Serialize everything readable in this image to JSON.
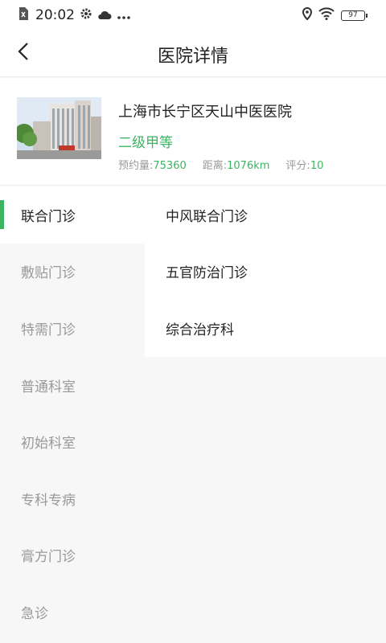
{
  "status_bar": {
    "time": "20:02",
    "battery": "97",
    "icons": [
      "sim-icon",
      "gear-icon",
      "cloud-icon",
      "more-icon",
      "location-icon",
      "wifi-icon",
      "battery-icon"
    ]
  },
  "nav": {
    "title": "医院详情",
    "back_icon": "chevron-left-icon"
  },
  "hospital": {
    "name": "上海市长宁区天山中医医院",
    "level": "二级甲等",
    "stats": {
      "appointments_label": "预约量:",
      "appointments_value": "75360",
      "distance_label": "距离:",
      "distance_value": "1076km",
      "rating_label": "评分:",
      "rating_value": "10"
    }
  },
  "categories": [
    {
      "label": "联合门诊",
      "active": true
    },
    {
      "label": "敷贴门诊"
    },
    {
      "label": "特需门诊"
    },
    {
      "label": "普通科室"
    },
    {
      "label": "初始科室"
    },
    {
      "label": "专科专病"
    },
    {
      "label": "膏方门诊"
    },
    {
      "label": "急诊"
    }
  ],
  "departments": [
    {
      "label": "中风联合门诊"
    },
    {
      "label": "五官防治门诊"
    },
    {
      "label": "综合治疗科"
    }
  ],
  "colors": {
    "accent": "#3cb462",
    "background": "#f7f7f7"
  }
}
